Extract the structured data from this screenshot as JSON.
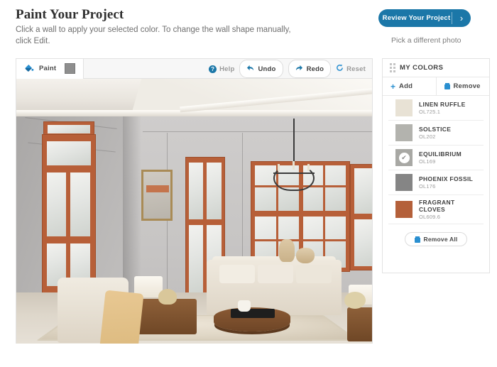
{
  "header": {
    "title": "Paint Your Project",
    "subtitle": "Click a wall to apply your selected color. To change the wall shape manually, click Edit.",
    "review_button": "Review Your Project",
    "review_chevron": "chevron-right-icon",
    "pick_photo_link": "Pick a different photo"
  },
  "toolbar": {
    "paint_tab": "Paint",
    "paint_icon": "paint-bucket-icon",
    "active_color_hex": "#8e8e8e",
    "help": "Help",
    "help_icon": "question-mark-icon",
    "undo": "Undo",
    "undo_icon": "undo-arrow-icon",
    "redo": "Redo",
    "redo_icon": "redo-arrow-icon",
    "reset": "Reset",
    "reset_icon": "refresh-icon"
  },
  "canvas": {
    "scene": "living room interior with gray walls, terracotta painted door and window frames, cream sofa, armchair, wood coffee table and beige area rug"
  },
  "colors_panel": {
    "title": "MY COLORS",
    "grid_icon": "grid-handle-icon",
    "add_label": "Add",
    "add_icon": "plus-icon",
    "remove_label": "Remove",
    "remove_icon": "trash-icon",
    "remove_all_label": "Remove All",
    "remove_all_icon": "trash-icon",
    "selected_index": 2,
    "colors": [
      {
        "name": "LINEN RUFFLE",
        "code": "OL725.1",
        "hex": "#e8e2d5",
        "selected": false
      },
      {
        "name": "SOLSTICE",
        "code": "OL202",
        "hex": "#b3b3ae",
        "selected": false
      },
      {
        "name": "EQUILIBRIUM",
        "code": "OL169",
        "hex": "#a8a8a4",
        "selected": true
      },
      {
        "name": "PHOENIX FOSSIL",
        "code": "OL176",
        "hex": "#858585",
        "selected": false
      },
      {
        "name": "FRAGRANT CLOVES",
        "code": "OL609.6",
        "hex": "#b4603a",
        "selected": false
      }
    ]
  },
  "accent_colors": {
    "brand_blue": "#1b77a8",
    "icon_blue": "#2a8fd0"
  }
}
